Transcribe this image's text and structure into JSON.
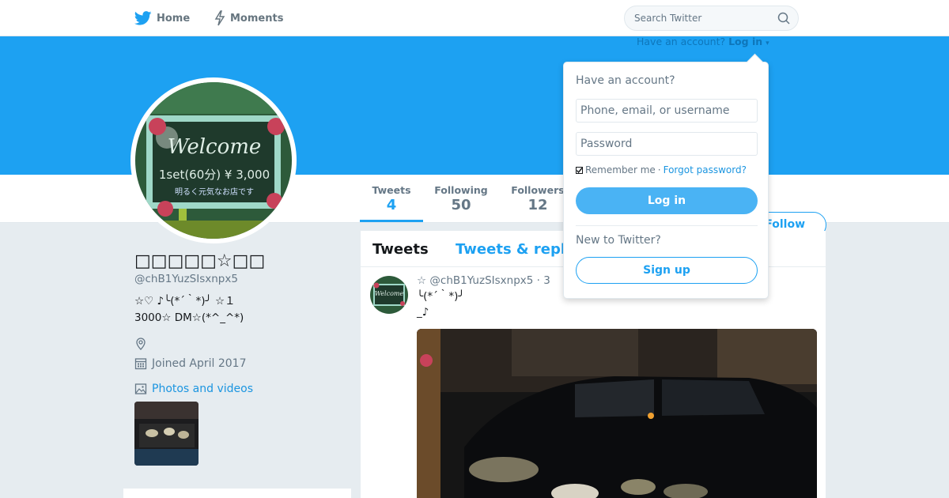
{
  "nav": {
    "home_label": "Home",
    "moments_label": "Moments",
    "search_placeholder": "Search Twitter"
  },
  "header": {
    "have_account_prefix": "Have an account?",
    "login_link": "Log in"
  },
  "stats": {
    "tweets_label": "Tweets",
    "tweets_value": "4",
    "following_label": "Following",
    "following_value": "50",
    "followers_label": "Followers",
    "followers_value": "12"
  },
  "follow_button": "Follow",
  "profile": {
    "name": "□□□□□☆□□",
    "handle": "@chB1YuzSIsxnpx5",
    "bio_line1": "☆♡ ♪╰(*´｀*)╯ ☆１",
    "bio_line2": "3000☆ DM☆(*^_^*)",
    "joined": "Joined April 2017",
    "photos_label": "Photos and videos"
  },
  "timeline": {
    "tab_tweets": "Tweets",
    "tab_replies": "Tweets & replies"
  },
  "tweet": {
    "header": "☆ @chB1YuzSIsxnpx5 · 3",
    "line1": "╰(*´｀*)╯",
    "line2": "_♪"
  },
  "login_dropdown": {
    "title": "Have an account?",
    "phone_placeholder": "Phone, email, or username",
    "password_placeholder": "Password",
    "remember_label": "Remember me",
    "separator": "·",
    "forgot_label": "Forgot password?",
    "login_button": "Log in",
    "new_label": "New to Twitter?",
    "signup_button": "Sign up"
  },
  "colors": {
    "brand": "#1da1f2",
    "page_bg": "#e6ecf0",
    "link": "#1b95e0"
  }
}
